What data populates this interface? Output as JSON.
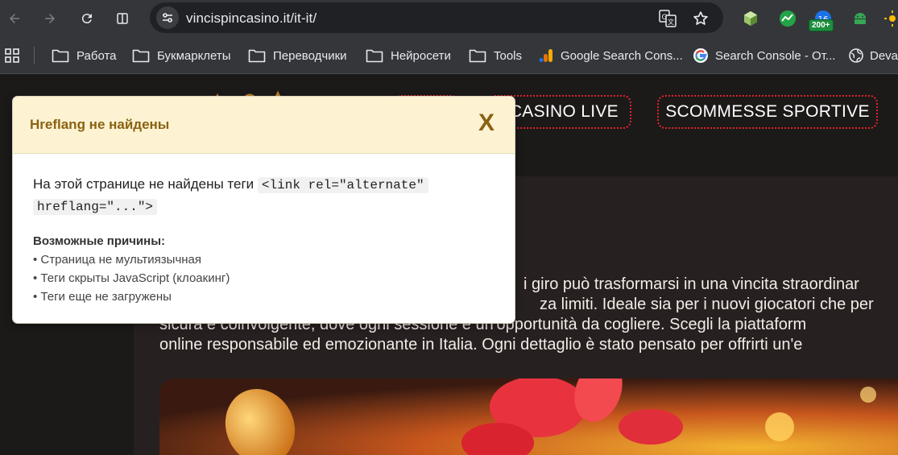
{
  "browser": {
    "url": "vincispincasino.it/it-it/",
    "badge": "200+"
  },
  "bookmarks": [
    {
      "label": "Работа",
      "icon": "folder-icon"
    },
    {
      "label": "Букмарклеты",
      "icon": "folder-icon"
    },
    {
      "label": "Переводчики",
      "icon": "folder-icon"
    },
    {
      "label": "Нейросети",
      "icon": "folder-icon"
    },
    {
      "label": "Tools",
      "icon": "folder-icon"
    },
    {
      "label": "Google Search Cons...",
      "icon": "analytics-icon"
    },
    {
      "label": "Search Console - От...",
      "icon": "google-icon"
    },
    {
      "label": "Deval",
      "icon": "globe-icon"
    }
  ],
  "site": {
    "nav": {
      "casino_live": "CASINO LIVE",
      "sports_betting": "SCOMMESSE SPORTIVE"
    },
    "hero_lines": [
      "i giro può trasformarsi in una vincita straordinar",
      "za limiti. Ideale sia per i nuovi giocatori che per",
      "sicura e coinvolgente, dove ogni sessione è un'opportunità da cogliere. Scegli la piattaform",
      "online responsabile ed emozionante in Italia. Ogni dettaglio è stato pensato per offrirti un'e"
    ]
  },
  "popup": {
    "title": "Hreflang не найдены",
    "close_label": "X",
    "message_prefix": "На этой странице не найдены теги",
    "code_part1": "<link rel=\"alternate\"",
    "code_part2": "hreflang=\"...\">",
    "reasons_title": "Возможные причины:",
    "reasons": [
      "• Страница не мультиязычная",
      "• Теги скрыты JavaScript (клоакинг)",
      "• Теги еще не загружены"
    ]
  }
}
